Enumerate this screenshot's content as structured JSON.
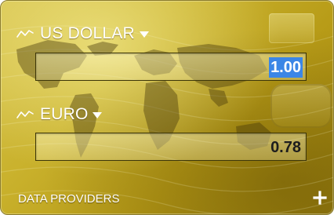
{
  "currency_converter": {
    "from": {
      "currency_label": "US DOLLAR",
      "amount": "1.00",
      "amount_selected": true
    },
    "to": {
      "currency_label": "EURO",
      "amount": "0.78"
    },
    "footer": {
      "data_providers_label": "DATA PROVIDERS",
      "add_icon": "plus-icon"
    }
  },
  "icons": {
    "trend": "trend-line-icon",
    "dropdown": "caret-down-icon",
    "add": "plus-icon"
  },
  "colors": {
    "gold_light": "#d6c24a",
    "gold_dark": "#9c8210",
    "selection": "#3b86e6",
    "text_light": "#ffffff",
    "text_dark": "#1d1d1d"
  }
}
